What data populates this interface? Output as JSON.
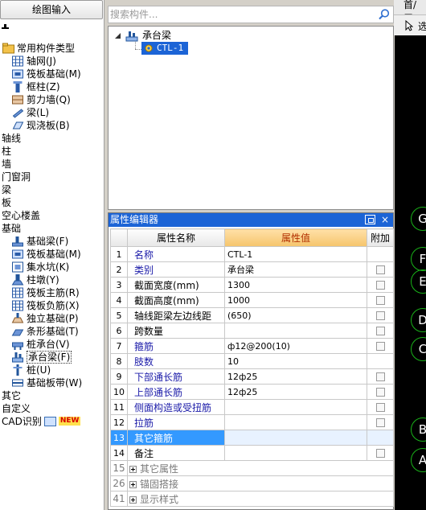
{
  "left_panel": {
    "top_button": "绘图输入",
    "items": [
      {
        "label": "常用构件类型"
      },
      {
        "label": "轴网(J)"
      },
      {
        "label": "筏板基础(M)"
      },
      {
        "label": "框柱(Z)"
      },
      {
        "label": "剪力墙(Q)"
      },
      {
        "label": "梁(L)"
      },
      {
        "label": "现浇板(B)"
      },
      {
        "label": "轴线"
      },
      {
        "label": "柱"
      },
      {
        "label": "墙"
      },
      {
        "label": "门窗洞"
      },
      {
        "label": "梁"
      },
      {
        "label": "板"
      },
      {
        "label": "空心楼盖"
      },
      {
        "label": "基础"
      },
      {
        "label": "基础梁(F)"
      },
      {
        "label": "筏板基础(M)"
      },
      {
        "label": "集水坑(K)"
      },
      {
        "label": "柱墩(Y)"
      },
      {
        "label": "筏板主筋(R)"
      },
      {
        "label": "筏板负筋(X)"
      },
      {
        "label": "独立基础(P)"
      },
      {
        "label": "条形基础(T)"
      },
      {
        "label": "桩承台(V)"
      },
      {
        "label": "承台梁(F)"
      },
      {
        "label": "桩(U)"
      },
      {
        "label": "基础板带(W)"
      },
      {
        "label": "其它"
      },
      {
        "label": "自定义"
      },
      {
        "label": "CAD识别"
      }
    ],
    "new_badge": "NEW"
  },
  "search": {
    "placeholder": "搜索构件..."
  },
  "tree": {
    "root": "承台梁",
    "child": "CTL-1"
  },
  "editor": {
    "title": "属性编辑器",
    "close": "×",
    "columns": [
      "属性名称",
      "属性值",
      "附加"
    ],
    "rows": [
      {
        "n": "1",
        "name": "名称",
        "value": "CTL-1",
        "blue": true,
        "check": false
      },
      {
        "n": "2",
        "name": "类别",
        "value": "承台梁",
        "blue": true,
        "check": true
      },
      {
        "n": "3",
        "name": "截面宽度(mm)",
        "value": "1300",
        "blue": false,
        "check": true
      },
      {
        "n": "4",
        "name": "截面高度(mm)",
        "value": "1000",
        "blue": false,
        "check": true
      },
      {
        "n": "5",
        "name": "轴线距梁左边线距",
        "value": "(650)",
        "blue": false,
        "check": true
      },
      {
        "n": "6",
        "name": "跨数量",
        "value": "",
        "blue": false,
        "check": true
      },
      {
        "n": "7",
        "name": "箍筋",
        "value": "ф12@200(10)",
        "blue": true,
        "check": true
      },
      {
        "n": "8",
        "name": "肢数",
        "value": "10",
        "blue": true,
        "check": false
      },
      {
        "n": "9",
        "name": "下部通长筋",
        "value": "12ф25",
        "blue": true,
        "check": true
      },
      {
        "n": "10",
        "name": "上部通长筋",
        "value": "12ф25",
        "blue": true,
        "check": true
      },
      {
        "n": "11",
        "name": "侧面构造或受扭筋",
        "value": "",
        "blue": true,
        "check": true
      },
      {
        "n": "12",
        "name": "拉筋",
        "value": "",
        "blue": true,
        "check": true
      },
      {
        "n": "13",
        "name": "其它箍筋",
        "value": "",
        "blue": false,
        "check": false,
        "selected": true
      },
      {
        "n": "14",
        "name": "备注",
        "value": "",
        "blue": false,
        "check": true
      },
      {
        "n": "15",
        "name": "其它属性",
        "value": "",
        "group": true
      },
      {
        "n": "26",
        "name": "锚固搭接",
        "value": "",
        "group": true
      },
      {
        "n": "41",
        "name": "显示样式",
        "value": "",
        "group": true
      }
    ]
  },
  "right_canvas": {
    "menu_label": "首/层",
    "tool_label": "选",
    "axis_labels": [
      "G",
      "F",
      "E",
      "D",
      "C",
      "B",
      "A"
    ]
  },
  "colors": {
    "title_bar": "#1c64d6",
    "selection": "#3399ff",
    "axis_circle": "#19b319",
    "canvas_bg": "#000000"
  }
}
